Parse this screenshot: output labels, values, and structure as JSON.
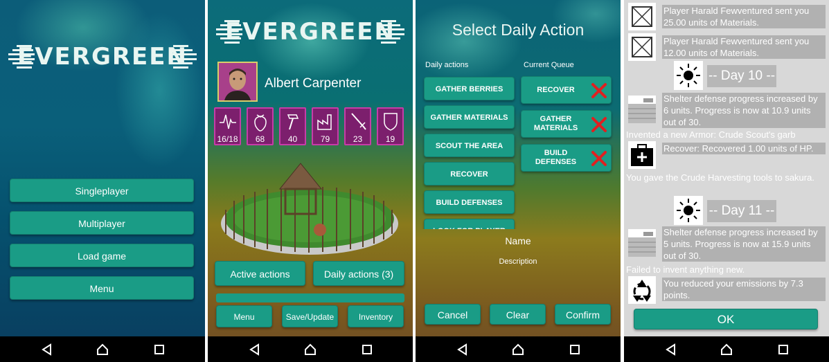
{
  "app": {
    "logo_text": "EVERGREEN"
  },
  "main_menu": {
    "buttons": [
      "Singleplayer",
      "Multiplayer",
      "Load game",
      "Menu"
    ]
  },
  "character": {
    "name": "Albert Carpenter",
    "stats": [
      {
        "icon": "heartbeat-icon",
        "value": "16/18"
      },
      {
        "icon": "strawberry-icon",
        "value": "68"
      },
      {
        "icon": "hammer-icon",
        "value": "40"
      },
      {
        "icon": "factory-icon",
        "value": "79"
      },
      {
        "icon": "sword-icon",
        "value": "23"
      },
      {
        "icon": "shield-icon",
        "value": "19"
      }
    ],
    "active_actions_label": "Active actions",
    "daily_actions_label": "Daily actions (3)",
    "menu_label": "Menu",
    "save_label": "Save/Update",
    "inventory_label": "Inventory"
  },
  "select_action": {
    "title": "Select Daily Action",
    "daily_header": "Daily actions",
    "queue_header": "Current Queue",
    "daily_actions": [
      "GATHER BERRIES",
      "GATHER MATERIALS",
      "SCOUT THE AREA",
      "RECOVER",
      "BUILD DEFENSES",
      "LOOK FOR PLAYER"
    ],
    "queue": [
      "RECOVER",
      "GATHER MATERIALS",
      "BUILD DEFENSES"
    ],
    "name_label": "Name",
    "description_label": "Description",
    "cancel_label": "Cancel",
    "clear_label": "Clear",
    "confirm_label": "Confirm"
  },
  "log": {
    "entry1": "Player Harald Fewventured sent you 25.00 units of Materials.",
    "entry2": "Player Harald Fewventured sent you 12.00 units of Materials.",
    "day10": "-- Day 10 --",
    "entry3": "Shelter defense progress increased by 6 units. Progress is now at 10.9 units out of 30.",
    "entry4": "Invented a new Armor: Crude Scout's garb",
    "entry5": "Recover: Recovered 1.00 units of HP.",
    "entry6": "You gave the Crude Harvesting tools to sakura.",
    "day11": "-- Day 11 --",
    "entry7": "Shelter defense progress increased by 5 units. Progress is now at 15.9 units out of 30.",
    "entry8": "Failed to invent anything new.",
    "entry9": "You reduced your emissions by 7.3 points.",
    "ok_label": "OK"
  },
  "colors": {
    "button": "#1a9c86",
    "stat_bg": "#7c1f6d",
    "stat_border": "#c73ca8",
    "remove": "#e02020"
  }
}
